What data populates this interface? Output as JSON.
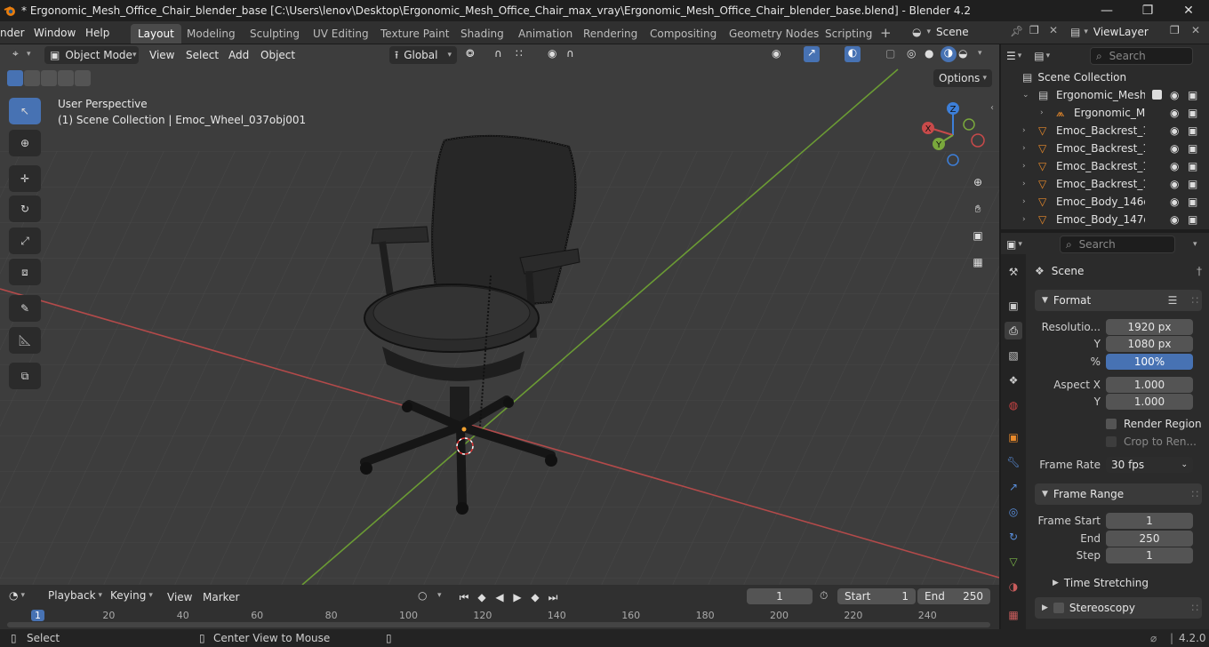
{
  "window": {
    "title": "* Ergonomic_Mesh_Office_Chair_blender_base [C:\\Users\\lenov\\Desktop\\Ergonomic_Mesh_Office_Chair_max_vray\\Ergonomic_Mesh_Office_Chair_blender_base.blend] - Blender 4.2"
  },
  "menubar": {
    "items": [
      "nder",
      "Window",
      "Help"
    ]
  },
  "workspaces": [
    "Layout",
    "Modeling",
    "Sculpting",
    "UV Editing",
    "Texture Paint",
    "Shading",
    "Animation",
    "Rendering",
    "Compositing",
    "Geometry Nodes",
    "Scripting"
  ],
  "scene": {
    "name": "Scene",
    "view_layer": "ViewLayer"
  },
  "viewport": {
    "mode": "Object Mode",
    "menus": [
      "View",
      "Select",
      "Add",
      "Object"
    ],
    "orientation": "Global",
    "options_label": "Options",
    "view_name": "User Perspective",
    "collection_info": "(1) Scene Collection | Emoc_Wheel_037obj001",
    "gizmo": {
      "x": "X",
      "y": "Y",
      "z": "Z"
    }
  },
  "outliner": {
    "search_placeholder": "Search",
    "root": "Scene Collection",
    "rows": [
      {
        "label": "Ergonomic_Mesh_(",
        "indent": 1,
        "type": "collection"
      },
      {
        "label": "Ergonomic_Me",
        "indent": 2,
        "type": "armature"
      },
      {
        "label": "Emoc_Backrest_14",
        "indent": 1,
        "type": "mesh"
      },
      {
        "label": "Emoc_Backrest_14",
        "indent": 1,
        "type": "mesh"
      },
      {
        "label": "Emoc_Backrest_14",
        "indent": 1,
        "type": "mesh"
      },
      {
        "label": "Emoc_Backrest_14",
        "indent": 1,
        "type": "mesh"
      },
      {
        "label": "Emoc_Body_146ob",
        "indent": 1,
        "type": "mesh"
      },
      {
        "label": "Emoc_Body_147ob",
        "indent": 1,
        "type": "mesh"
      }
    ]
  },
  "properties": {
    "search_placeholder": "Search",
    "context": "Scene",
    "format": {
      "header": "Format",
      "res_x_label": "Resolutio...",
      "res_x": "1920 px",
      "res_y_label": "Y",
      "res_y": "1080 px",
      "pct_label": "%",
      "pct": "100%",
      "aspect_x_label": "Aspect X",
      "aspect_x": "1.000",
      "aspect_y_label": "Y",
      "aspect_y": "1.000",
      "render_region": "Render Region",
      "crop": "Crop to Ren...",
      "frame_rate_label": "Frame Rate",
      "frame_rate": "30 fps"
    },
    "frame_range": {
      "header": "Frame Range",
      "start_label": "Frame Start",
      "start": "1",
      "end_label": "End",
      "end": "250",
      "step_label": "Step",
      "step": "1",
      "time_stretching": "Time Stretching",
      "stereoscopy": "Stereoscopy"
    }
  },
  "timeline": {
    "menus": [
      "Playback",
      "Keying",
      "View",
      "Marker"
    ],
    "current_frame": "1",
    "start_label": "Start",
    "start": "1",
    "end_label": "End",
    "end": "250",
    "ticks": [
      "1",
      "20",
      "40",
      "60",
      "80",
      "100",
      "120",
      "140",
      "160",
      "180",
      "200",
      "220",
      "240"
    ]
  },
  "statusbar": {
    "select": "Select",
    "center_view": "Center View to Mouse",
    "version": "4.2.0"
  },
  "colors": {
    "accent": "#4772b3",
    "x_axis": "#c84a4a",
    "y_axis": "#7aa83c",
    "z_axis": "#3d7fd9"
  }
}
